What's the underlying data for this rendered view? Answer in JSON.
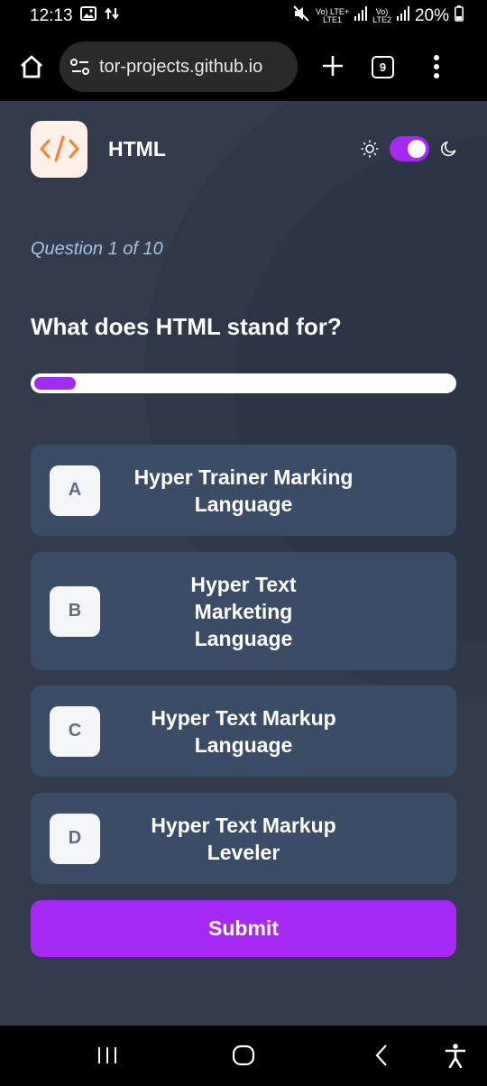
{
  "status_bar": {
    "time": "12:13",
    "lte1": "Vo) LTE+",
    "lte1_sub": "LTE1",
    "lte2": "Vo)",
    "lte2_sub": "LTE2",
    "battery": "20%"
  },
  "browser": {
    "url": "tor-projects.github.io",
    "tab_count": "9"
  },
  "app": {
    "subject": "HTML",
    "logo_glyph": "</>",
    "theme_dark_enabled": true,
    "question_count": "Question 1 of 10",
    "question": "What does HTML stand for?",
    "progress": 0.1,
    "options": [
      {
        "letter": "A",
        "text": "Hyper Trainer Marking Language"
      },
      {
        "letter": "B",
        "text": "Hyper Text Marketing Language"
      },
      {
        "letter": "C",
        "text": "Hyper Text Markup Language"
      },
      {
        "letter": "D",
        "text": "Hyper Text Markup Leveler"
      }
    ],
    "submit_label": "Submit"
  },
  "colors": {
    "accent": "#a729f5",
    "background": "#323c4d",
    "option_bg": "#3b4d66",
    "logo_bg": "#fff0e8",
    "logo_fg": "#ff7e35"
  }
}
